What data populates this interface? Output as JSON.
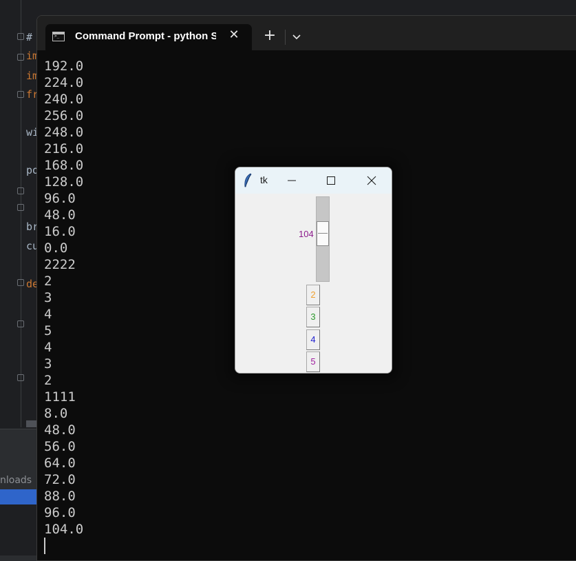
{
  "ide": {
    "fragments": [
      "#",
      "im",
      "im",
      "fr",
      "wi",
      "po",
      "br",
      "cu",
      "de"
    ],
    "downloads_label": "nloads"
  },
  "terminal": {
    "tab_title": "Command Prompt - python S",
    "tab_close_glyph": "✕",
    "new_tab_glyph": "+",
    "lines": [
      "192.0",
      "224.0",
      "240.0",
      "256.0",
      "248.0",
      "216.0",
      "168.0",
      "128.0",
      "96.0",
      "48.0",
      "16.0",
      "0.0",
      "2222",
      "2",
      "3",
      "4",
      "5",
      "4",
      "3",
      "2",
      "1111",
      "8.0",
      "48.0",
      "56.0",
      "64.0",
      "72.0",
      "88.0",
      "96.0",
      "104.0"
    ]
  },
  "tk": {
    "title": "tk",
    "scale": {
      "value_label": "104",
      "value_fraction": 0.41
    },
    "buttons": [
      {
        "label": "2",
        "color": "#f0a030"
      },
      {
        "label": "3",
        "color": "#2e9a2e"
      },
      {
        "label": "4",
        "color": "#2020d0"
      },
      {
        "label": "5",
        "color": "#a020a0"
      }
    ]
  },
  "colors": {
    "terminal_bg": "#0c0c0c",
    "terminal_text": "#cccccc",
    "ide_keyword": "#cc7832",
    "scale_label": "#8b1a8b"
  }
}
